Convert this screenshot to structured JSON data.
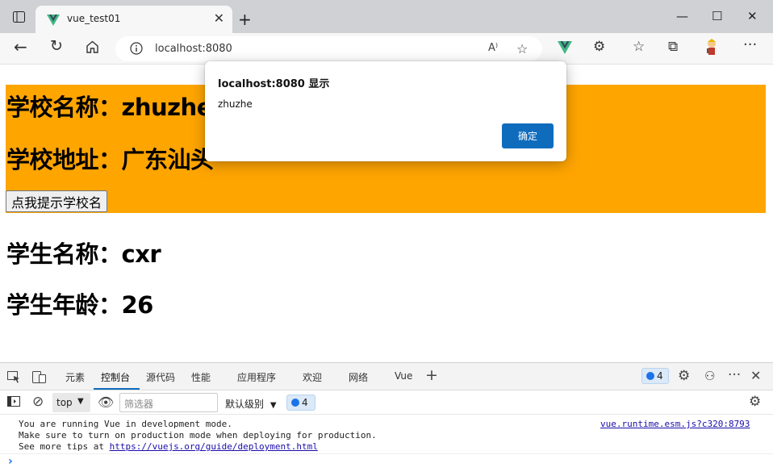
{
  "window": {
    "tab_title": "vue_test01",
    "tab_close": "✕",
    "new_tab": "+",
    "controls": {
      "minimize": "—",
      "maximize": "☐",
      "close": "✕"
    }
  },
  "toolbar": {
    "url": "localhost:8080"
  },
  "page": {
    "school_name": "学校名称：zhuzhe",
    "school_address": "学校地址：广东汕头",
    "school_button": "点我提示学校名",
    "student_name": "学生名称：cxr",
    "student_age": "学生年龄：26",
    "school_bg": "#ffa500"
  },
  "dialog": {
    "title": "localhost:8080 显示",
    "message": "zhuzhe",
    "ok_label": "确定"
  },
  "devtools": {
    "tabs": [
      "元素",
      "控制台",
      "源代码",
      "性能",
      "应用程序",
      "欢迎",
      "网络",
      "Vue"
    ],
    "active_tab": "控制台",
    "issues_count": "4",
    "context": "top",
    "filter_placeholder": "筛选器",
    "level": "默认级别",
    "messages_count": "4",
    "console": {
      "line1": "You are running Vue in development mode.",
      "line2": "Make sure to turn on production mode when deploying for production.",
      "line3_prefix": "See more tips at ",
      "line3_link": "https://vuejs.org/guide/deployment.html",
      "source": "vue.runtime.esm.js?c320:8793",
      "prompt": "›"
    }
  }
}
